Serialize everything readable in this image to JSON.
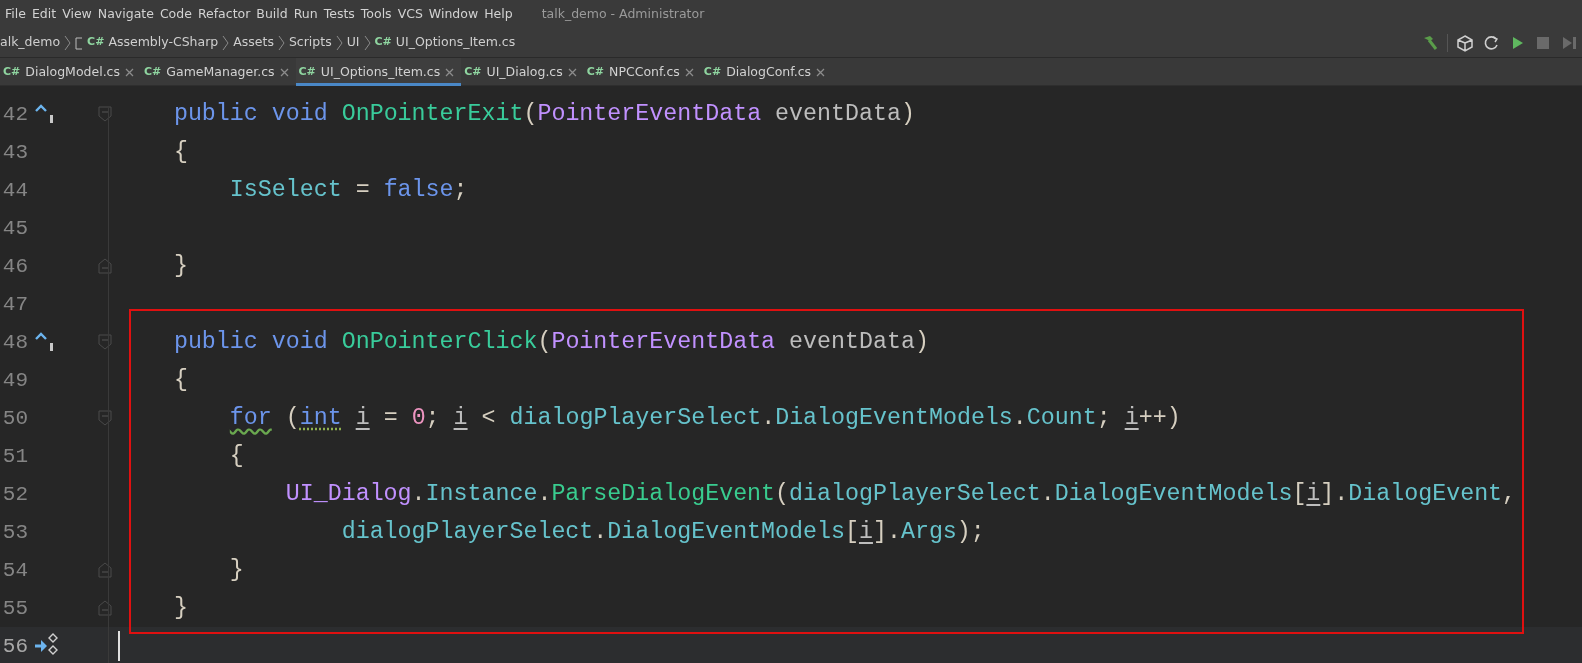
{
  "menu": [
    "File",
    "Edit",
    "View",
    "Navigate",
    "Code",
    "Refactor",
    "Build",
    "Run",
    "Tests",
    "Tools",
    "VCS",
    "Window",
    "Help"
  ],
  "window": {
    "title": "talk_demo - Administrator"
  },
  "breadcrumbs": [
    {
      "label": "alk_demo",
      "kind": "project"
    },
    {
      "label": "Assembly-CSharp",
      "kind": "assembly",
      "badge": "C#"
    },
    {
      "label": "Assets",
      "kind": "folder"
    },
    {
      "label": "Scripts",
      "kind": "folder"
    },
    {
      "label": "UI",
      "kind": "folder"
    },
    {
      "label": "UI_Options_Item.cs",
      "kind": "file",
      "badge": "C#"
    }
  ],
  "toolbar": [
    {
      "kind": "build"
    },
    {
      "kind": "separator"
    },
    {
      "kind": "unity"
    },
    {
      "kind": "refresh"
    },
    {
      "kind": "play",
      "disabled": false
    },
    {
      "kind": "stop",
      "disabled": true
    },
    {
      "kind": "step",
      "disabled": true
    }
  ],
  "tabs": [
    {
      "badge": "C#",
      "label": "DialogModel.cs",
      "selected": false
    },
    {
      "badge": "C#",
      "label": "GameManager.cs",
      "selected": false
    },
    {
      "badge": "C#",
      "label": "UI_Options_Item.cs",
      "selected": true
    },
    {
      "badge": "C#",
      "label": "UI_Dialog.cs",
      "selected": false
    },
    {
      "badge": "C#",
      "label": "NPCConf.cs",
      "selected": false
    },
    {
      "badge": "C#",
      "label": "DialogConf.cs",
      "selected": false
    }
  ],
  "editor": {
    "highlight_frame": true,
    "lines": [
      {
        "number": "42",
        "current": false,
        "gutter_icon": {
          "kind": "implements"
        },
        "fold_marker": {
          "kind": "start"
        },
        "tokens": [
          {
            "text": "public ",
            "kind": "keyword"
          },
          {
            "text": "void ",
            "kind": "keyword"
          },
          {
            "text": "OnPointerExit",
            "kind": "method"
          },
          {
            "text": "(",
            "kind": "plain"
          },
          {
            "text": "PointerEventData ",
            "kind": "type"
          },
          {
            "text": "eventData",
            "kind": "param"
          },
          {
            "text": ")",
            "kind": "plain"
          }
        ]
      },
      {
        "number": "43",
        "current": false,
        "tokens": [
          {
            "text": "{",
            "kind": "plain"
          }
        ],
        "children": [
          {
            "number": "44",
            "current": false,
            "tokens": [
              {
                "text": "IsSelect",
                "kind": "field"
              },
              {
                "text": " = ",
                "kind": "plain"
              },
              {
                "text": "false",
                "kind": "keyword"
              },
              {
                "text": ";",
                "kind": "plain"
              }
            ]
          },
          {
            "number": "45",
            "current": false
          }
        ]
      },
      {
        "number": "46",
        "current": false,
        "fold_marker": {
          "kind": "end"
        },
        "tokens": [
          {
            "text": "}",
            "kind": "plain"
          }
        ]
      },
      {
        "number": "47",
        "current": false
      },
      {
        "number": "48",
        "current": false,
        "gutter_icon": {
          "kind": "implements"
        },
        "fold_marker": {
          "kind": "start"
        },
        "tokens": [
          {
            "text": "public ",
            "kind": "keyword"
          },
          {
            "text": "void ",
            "kind": "keyword"
          },
          {
            "text": "OnPointerClick",
            "kind": "method"
          },
          {
            "text": "(",
            "kind": "plain"
          },
          {
            "text": "PointerEventData ",
            "kind": "type"
          },
          {
            "text": "eventData",
            "kind": "param"
          },
          {
            "text": ")",
            "kind": "plain"
          }
        ]
      },
      {
        "number": "49",
        "current": false,
        "tokens": [
          {
            "text": "{",
            "kind": "plain"
          }
        ],
        "children": [
          {
            "number": "50",
            "current": false,
            "fold_marker": {
              "kind": "start"
            },
            "tokens": [
              {
                "text": "for",
                "kind": "keyword-warning"
              },
              {
                "text": " (",
                "kind": "plain"
              },
              {
                "text": "int ",
                "kind": "keyword-hint"
              },
              {
                "text": "i",
                "kind": "local"
              },
              {
                "text": " = ",
                "kind": "plain"
              },
              {
                "text": "0",
                "kind": "number"
              },
              {
                "text": "; ",
                "kind": "plain"
              },
              {
                "text": "i",
                "kind": "local"
              },
              {
                "text": " < ",
                "kind": "plain"
              },
              {
                "text": "dialogPlayerSelect",
                "kind": "field"
              },
              {
                "text": ".",
                "kind": "plain"
              },
              {
                "text": "DialogEventModels",
                "kind": "field"
              },
              {
                "text": ".",
                "kind": "plain"
              },
              {
                "text": "Count",
                "kind": "field"
              },
              {
                "text": "; ",
                "kind": "plain"
              },
              {
                "text": "i",
                "kind": "local"
              },
              {
                "text": "++)",
                "kind": "plain"
              }
            ]
          },
          {
            "number": "51",
            "current": false,
            "tokens": [
              {
                "text": "{",
                "kind": "plain"
              }
            ],
            "children": [
              {
                "number": "52",
                "current": false,
                "tokens": [
                  {
                    "text": "UI_Dialog",
                    "kind": "type"
                  },
                  {
                    "text": ".",
                    "kind": "plain"
                  },
                  {
                    "text": "Instance",
                    "kind": "field"
                  },
                  {
                    "text": ".",
                    "kind": "plain"
                  },
                  {
                    "text": "ParseDialogEvent",
                    "kind": "call"
                  },
                  {
                    "text": "(",
                    "kind": "plain"
                  },
                  {
                    "text": "dialogPlayerSelect",
                    "kind": "field"
                  },
                  {
                    "text": ".",
                    "kind": "plain"
                  },
                  {
                    "text": "DialogEventModels",
                    "kind": "field"
                  },
                  {
                    "text": "[",
                    "kind": "plain"
                  },
                  {
                    "text": "i",
                    "kind": "local"
                  },
                  {
                    "text": "].",
                    "kind": "plain"
                  },
                  {
                    "text": "DialogEvent",
                    "kind": "field"
                  },
                  {
                    "text": ",",
                    "kind": "plain"
                  }
                ],
                "children": [
                  {
                    "number": "53",
                    "current": false,
                    "tokens": [
                      {
                        "text": "dialogPlayerSelect",
                        "kind": "field"
                      },
                      {
                        "text": ".",
                        "kind": "plain"
                      },
                      {
                        "text": "DialogEventModels",
                        "kind": "field"
                      },
                      {
                        "text": "[",
                        "kind": "plain"
                      },
                      {
                        "text": "i",
                        "kind": "local"
                      },
                      {
                        "text": "].",
                        "kind": "plain"
                      },
                      {
                        "text": "Args",
                        "kind": "field"
                      },
                      {
                        "text": ");",
                        "kind": "plain"
                      }
                    ]
                  }
                ]
              }
            ]
          },
          {
            "number": "54",
            "current": false,
            "fold_marker": {
              "kind": "end"
            },
            "tokens": [
              {
                "text": "}",
                "kind": "plain"
              }
            ]
          }
        ]
      },
      {
        "number": "55",
        "current": false,
        "fold_marker": {
          "kind": "end"
        },
        "tokens": [
          {
            "text": "}",
            "kind": "plain"
          }
        ]
      },
      {
        "number": "56",
        "current": true,
        "gutter_icon": {
          "kind": "navigate"
        }
      }
    ]
  }
}
